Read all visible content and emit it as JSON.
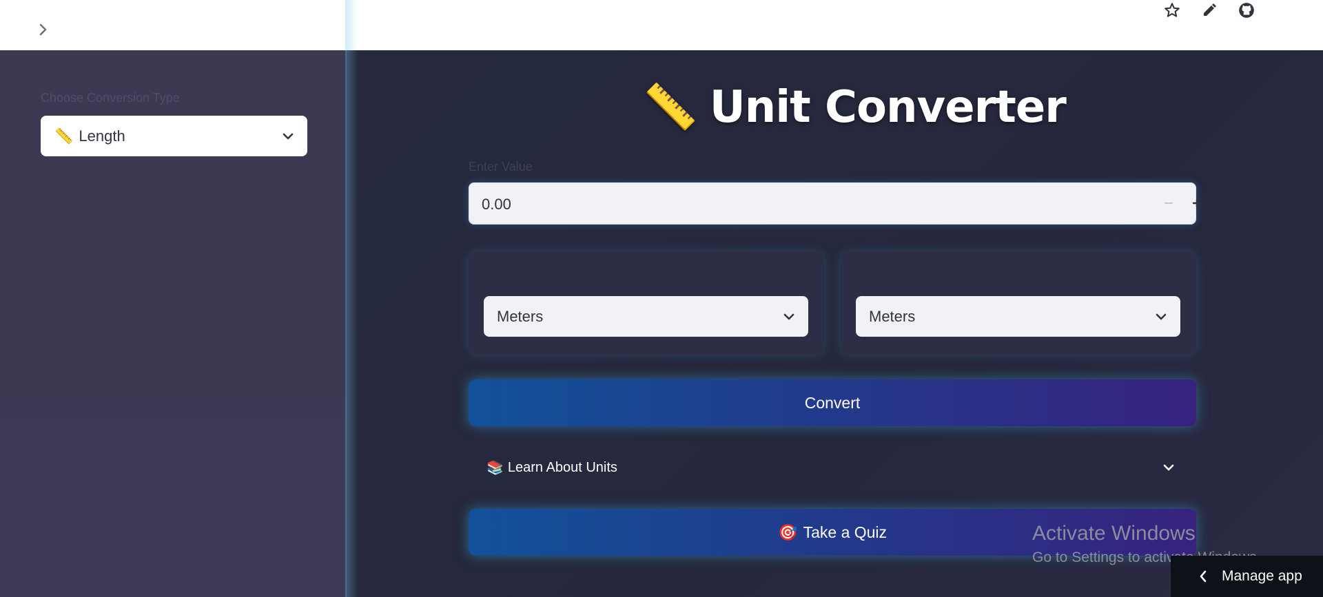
{
  "header": {
    "expand_sidebar_icon": "chevron-right-icon",
    "actions": [
      {
        "name": "star-icon"
      },
      {
        "name": "pencil-icon"
      },
      {
        "name": "github-icon"
      }
    ]
  },
  "sidebar": {
    "conversion_label": "Choose Conversion Type",
    "conversion_select": {
      "icon": "📏",
      "value": "Length"
    }
  },
  "main": {
    "title_emoji": "📏",
    "title": "Unit Converter",
    "value_label": "Enter Value",
    "value_input": "0.00",
    "from_unit": {
      "value": "Meters"
    },
    "to_unit": {
      "value": "Meters"
    },
    "convert_button": "Convert",
    "learn_expander": {
      "icon": "📚",
      "label": "Learn About Units"
    },
    "quiz_button": {
      "icon": "🎯",
      "label": "Take a Quiz"
    }
  },
  "watermark": {
    "title": "Activate Windows",
    "subtitle": "Go to Settings to activate Windows."
  },
  "manage_app": {
    "label": "Manage app"
  },
  "colors": {
    "sidebar_bg": "#3b3a52",
    "main_bg": "#262a3e",
    "button_gradient_start": "#12519a",
    "button_gradient_end": "#37227e",
    "glow": "#3caadc"
  }
}
